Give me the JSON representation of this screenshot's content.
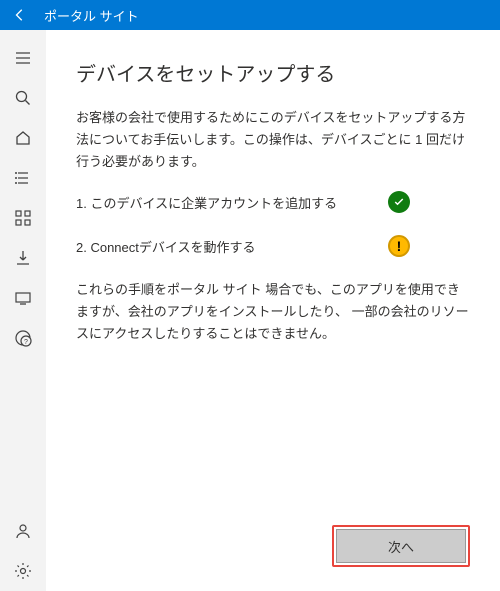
{
  "titlebar": {
    "app_name": "ポータル サイト"
  },
  "sidebar": {
    "items": [
      {
        "name": "hamburger-icon"
      },
      {
        "name": "search-icon"
      },
      {
        "name": "home-icon"
      },
      {
        "name": "list-icon"
      },
      {
        "name": "apps-icon"
      },
      {
        "name": "download-icon"
      },
      {
        "name": "device-icon"
      },
      {
        "name": "help-icon"
      }
    ],
    "bottom": [
      {
        "name": "profile-icon"
      },
      {
        "name": "settings-icon"
      }
    ]
  },
  "main": {
    "heading": "デバイスをセットアップする",
    "intro": "お客様の会社で使用するためにこのデバイスをセットアップする方法についてお手伝いします。この操作は、デバイスごとに 1 回だけ行う必要があります。",
    "steps": [
      {
        "label": "1. このデバイスに企業アカウントを追加する",
        "status": "success"
      },
      {
        "label": "2. Connectデバイスを動作する",
        "status": "warning"
      }
    ],
    "note": "これらの手順をポータル サイト 場合でも、このアプリを使用できますが、会社のアプリをインストールしたり、 一部の会社のリソースにアクセスしたりすることはできません。",
    "next_label": "次へ"
  }
}
